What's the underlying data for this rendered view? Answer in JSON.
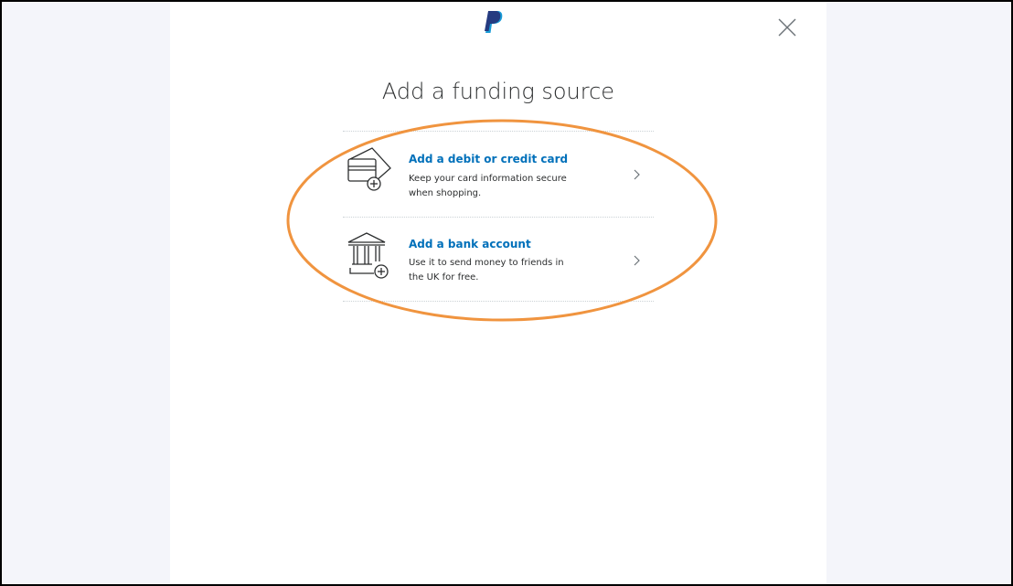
{
  "dialog": {
    "title": "Add a funding source",
    "logo_icon": "paypal-logo-icon",
    "close_icon": "close-icon"
  },
  "options": [
    {
      "title": "Add a debit or credit card",
      "description_line1": "Keep your card information secure",
      "description_line2": "when shopping.",
      "icon": "card-add-icon"
    },
    {
      "title": "Add a bank account",
      "description_line1": "Use it to send money to friends in",
      "description_line2": "the UK for free.",
      "icon": "bank-add-icon"
    }
  ],
  "colors": {
    "page_background": "#f4f5fa",
    "link_blue": "#0070ba",
    "highlight_orange": "#f0943f",
    "logo_dark": "#253b80",
    "logo_light": "#179bd7"
  }
}
